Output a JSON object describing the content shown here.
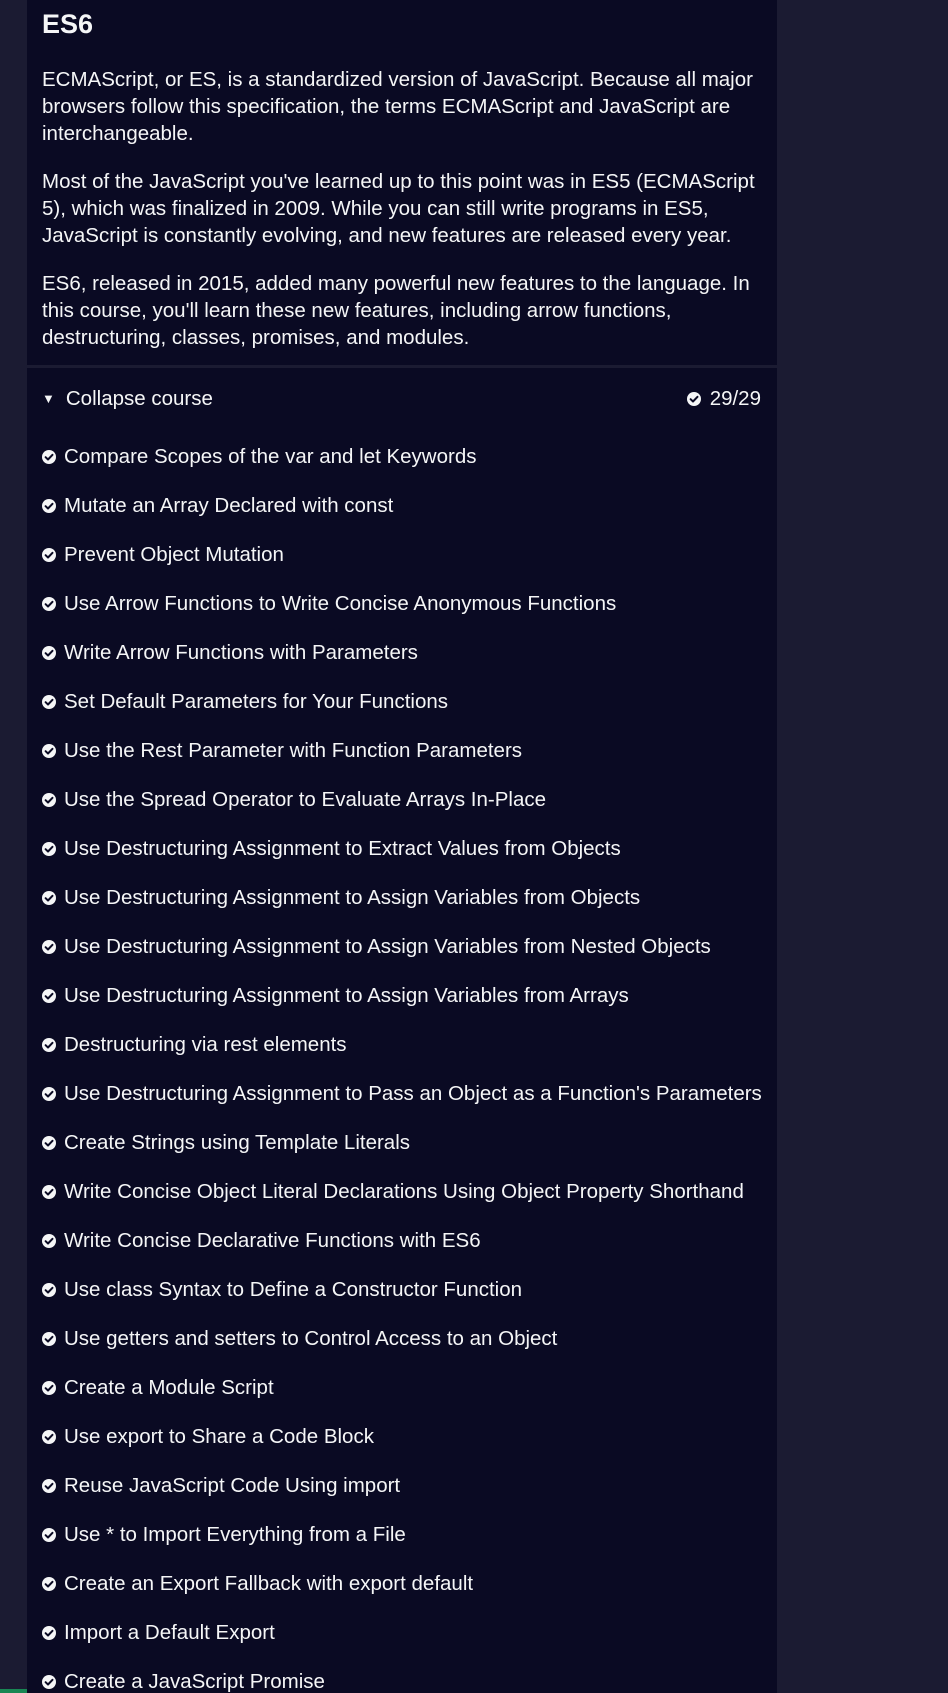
{
  "block": {
    "title": "ES6",
    "paragraphs": [
      "ECMAScript, or ES, is a standardized version of JavaScript. Because all major browsers follow this specification, the terms ECMAScript and JavaScript are interchangeable.",
      "Most of the JavaScript you've learned up to this point was in ES5 (ECMAScript 5), which was finalized in 2009. While you can still write programs in ES5, JavaScript is constantly evolving, and new features are released every year.",
      "ES6, released in 2015, added many powerful new features to the language. In this course, you'll learn these new features, including arrow functions, destructuring, classes, promises, and modules."
    ]
  },
  "course": {
    "collapse_label": "Collapse course",
    "caret_icon": "triangle-down-icon",
    "progress_text": "29/29",
    "check_icon": "check-circle-icon",
    "lessons": [
      "Compare Scopes of the var and let Keywords",
      "Mutate an Array Declared with const",
      "Prevent Object Mutation",
      "Use Arrow Functions to Write Concise Anonymous Functions",
      "Write Arrow Functions with Parameters",
      "Set Default Parameters for Your Functions",
      "Use the Rest Parameter with Function Parameters",
      "Use the Spread Operator to Evaluate Arrays In-Place",
      "Use Destructuring Assignment to Extract Values from Objects",
      "Use Destructuring Assignment to Assign Variables from Objects",
      "Use Destructuring Assignment to Assign Variables from Nested Objects",
      "Use Destructuring Assignment to Assign Variables from Arrays",
      "Destructuring via rest elements",
      "Use Destructuring Assignment to Pass an Object as a Function's Parameters",
      "Create Strings using Template Literals",
      "Write Concise Object Literal Declarations Using Object Property Shorthand",
      "Write Concise Declarative Functions with ES6",
      "Use class Syntax to Define a Constructor Function",
      "Use getters and setters to Control Access to an Object",
      "Create a Module Script",
      "Use export to Share a Code Block",
      "Reuse JavaScript Code Using import",
      "Use * to Import Everything from a File",
      "Create an Export Fallback with export default",
      "Import a Default Export",
      "Create a JavaScript Promise"
    ]
  },
  "colors": {
    "page_bg": "#1b1b32",
    "panel_bg": "#0a0a23",
    "text": "#f5f6f7",
    "accent_green": "#198754"
  }
}
